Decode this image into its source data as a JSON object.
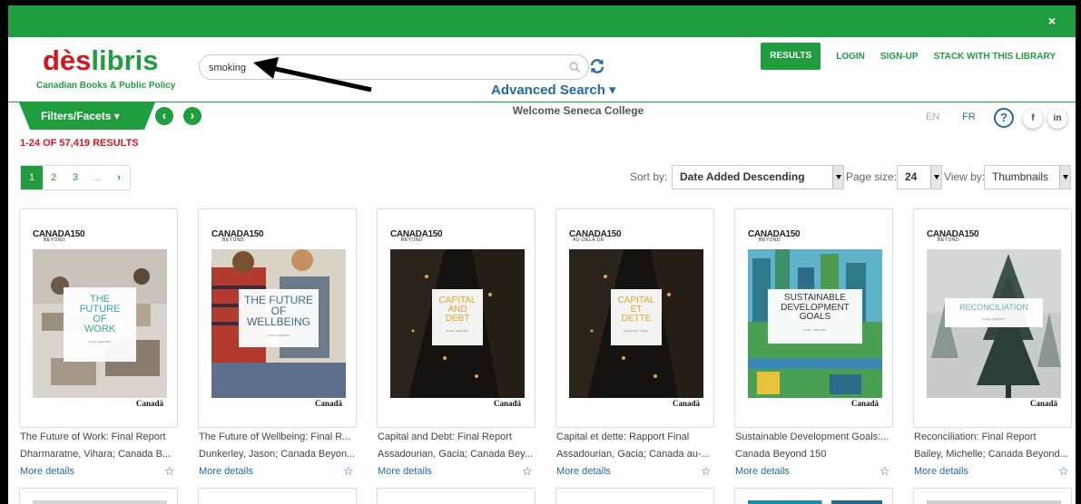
{
  "topbar": {
    "close_label": "×"
  },
  "logo": {
    "des": "dès",
    "libris": "libris",
    "tagline": "Canadian Books & Public Policy"
  },
  "search": {
    "value": "smoking",
    "placeholder": ""
  },
  "advanced_search": "Advanced Search ▾",
  "nav": {
    "results": "RESULTS",
    "login": "LOGIN",
    "signup": "SIGN-UP",
    "stack": "STACK WITH THIS LIBRARY"
  },
  "filters_label": "Filters/Facets ▾",
  "welcome": "Welcome Seneca College",
  "lang": {
    "en": "EN",
    "fr": "FR"
  },
  "help_label": "?",
  "social": {
    "facebook": "f",
    "linkedin": "in"
  },
  "results_count": "1-24 OF 57,419 RESULTS",
  "pager": [
    "1",
    "2",
    "3",
    "...",
    "›"
  ],
  "sort": {
    "label": "Sort by:",
    "value": "Date Added Descending"
  },
  "page_size": {
    "label": "Page size:",
    "value": "24"
  },
  "view_by": {
    "label": "View by:",
    "value": "Thumbnails"
  },
  "colors": {
    "brand_green": "#1f9d3f",
    "brand_red": "#d4171e",
    "link_blue": "#2468a8"
  },
  "cover_brand": {
    "c150": "CANADA150",
    "beyond": "BEYOND",
    "au_dela": "AU-DELÀ DE",
    "canada": "Canadä"
  },
  "books": [
    {
      "cover_title": "THE\nFUTURE\nOF\nWORK",
      "cover_sub": "FINAL REPORT",
      "title": "The Future of Work: Final Report",
      "author": "Dharmaratne, Vihara; Canada B...",
      "more": "More details"
    },
    {
      "cover_title": "THE FUTURE\nOF\nWELLBEING",
      "cover_sub": "FINAL REPORT",
      "title": "The Future of Wellbeing: Final R...",
      "author": "Dunkerley, Jason; Canada Beyon...",
      "more": "More details"
    },
    {
      "cover_title": "CAPITAL\nAND\nDEBT",
      "cover_sub": "FINAL REPORT",
      "title": "Capital and Debt: Final Report",
      "author": "Assadourian, Gacia; Canada Bey...",
      "more": "More details"
    },
    {
      "cover_title": "CAPITAL\nET\nDETTE",
      "cover_sub": "RAPPORT FINAL",
      "title": "Capital et dette: Rapport Final",
      "author": "Assadourian, Gacia; Canada au-...",
      "more": "More details"
    },
    {
      "cover_title": "SUSTAINABLE\nDEVELOPMENT\nGOALS",
      "cover_sub": "FINAL REPORT",
      "title": "Sustainable Development Goals:...",
      "author": "Canada Beyond 150",
      "more": "More details"
    },
    {
      "cover_title": "RECONCILIATION",
      "cover_sub": "FINAL REPORT",
      "title": "Reconciliation: Final Report",
      "author": "Bailey, Michelle; Canada Beyond...",
      "more": "More details"
    }
  ]
}
